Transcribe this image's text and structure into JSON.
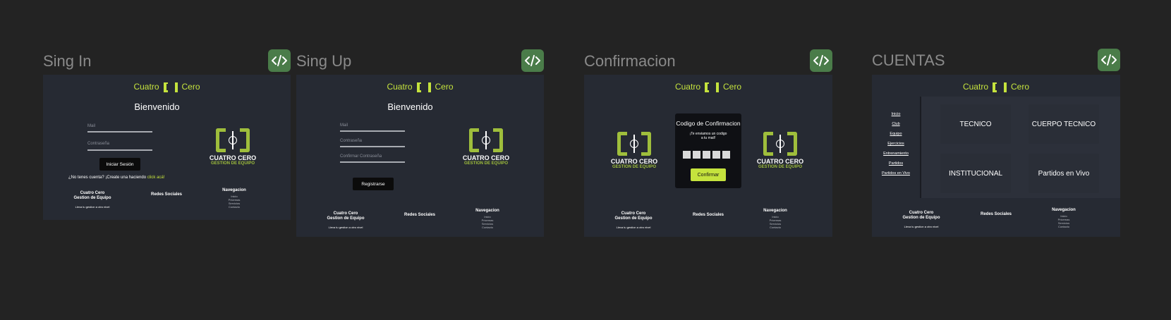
{
  "brand": {
    "left": "Cuatro",
    "right": "Cero"
  },
  "logo": {
    "title": "CUATRO CERO",
    "subtitle": "GESTION DE EQUIPO"
  },
  "footer": {
    "brand_line1": "Cuatro Cero",
    "brand_line2": "Gestion de Equipo",
    "tagline": "Lleva tu gestion a otro nivel",
    "social_title": "Redes Sociales",
    "nav_title": "Navegacion",
    "nav_links": [
      "Inicio",
      "Pricemas",
      "Servicios",
      "Contacto"
    ]
  },
  "frames": {
    "signin": {
      "title": "Sing In",
      "welcome": "Bienvenido",
      "mail_label": "Mail",
      "password_label": "Contraseña",
      "button": "Iniciar Sesión",
      "hint_prefix": "¿No tenes cuenta? ¡Create una haciendo",
      "hint_link": "click acá!"
    },
    "signup": {
      "title": "Sing Up",
      "welcome": "Bienvenido",
      "mail_label": "Mail",
      "password_label": "Contraseña",
      "confirm_label": "Confirmar Contraseña",
      "button": "Registrarse"
    },
    "confirm": {
      "title": "Confirmacion",
      "modal_title": "Codigo de Confirmacion",
      "modal_sub_1": "¡Te enviamos un codigo",
      "modal_sub_2": "a tu mail!",
      "button": "Confirmar"
    },
    "accounts": {
      "title": "CUENTAS",
      "menu": [
        "Inicio",
        "Club",
        "Equipo",
        "Ejercicios",
        "Entrenamiento",
        "Partidos",
        "Partidos en Vivo"
      ],
      "cards": [
        "TECNICO",
        "CUERPO TECNICO",
        "INSTITUCIONAL",
        "Partidos en Vivo"
      ]
    }
  },
  "colors": {
    "background": "#232323",
    "screen": "#262a33",
    "accent": "#c5e33d",
    "code_button": "#4a7c49"
  },
  "icons": {
    "code": "code-icon"
  }
}
